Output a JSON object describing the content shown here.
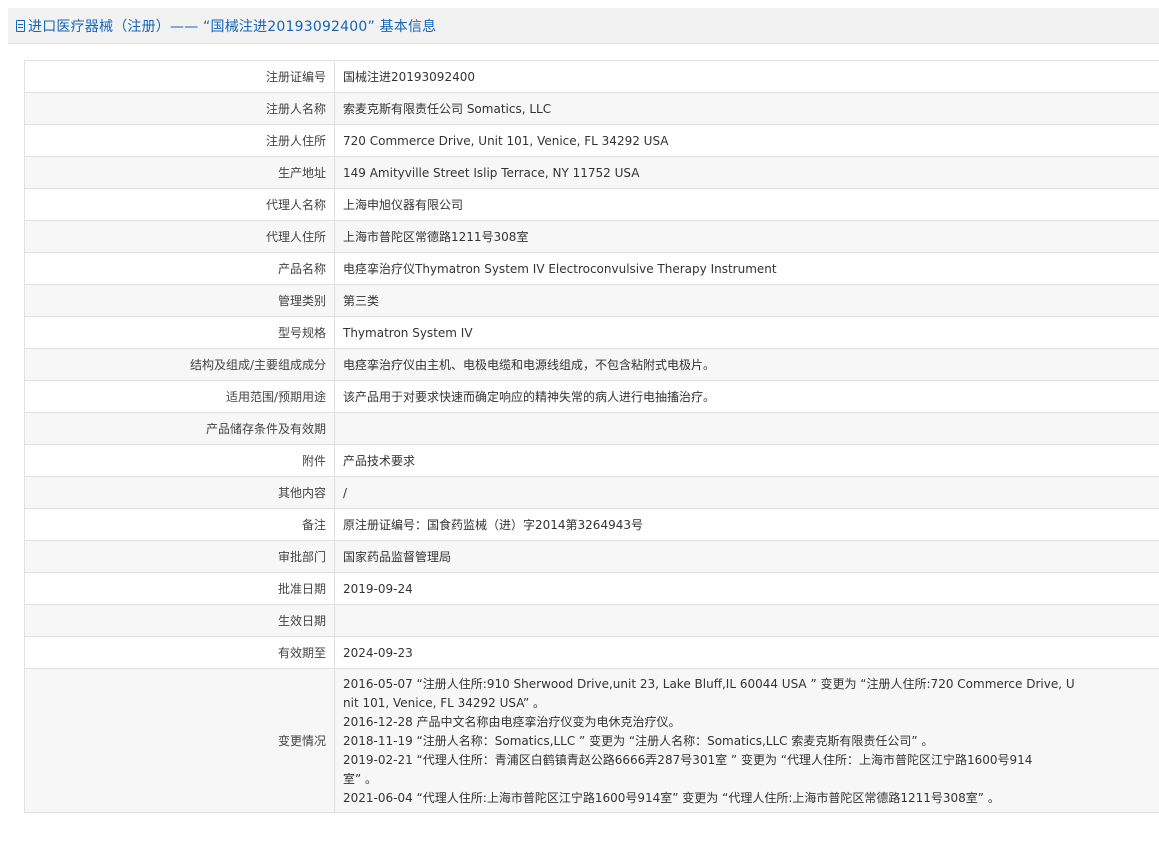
{
  "header": {
    "icon": "document-icon",
    "title": "进口医疗器械（注册）——  “国械注进20193092400” 基本信息"
  },
  "rows": [
    {
      "label": "注册证编号",
      "value": "国械注进20193092400"
    },
    {
      "label": "注册人名称",
      "value": "索麦克斯有限责任公司 Somatics, LLC"
    },
    {
      "label": "注册人住所",
      "value": "720 Commerce Drive, Unit 101, Venice, FL 34292 USA"
    },
    {
      "label": "生产地址",
      "value": "149 Amityville Street Islip Terrace, NY 11752 USA"
    },
    {
      "label": "代理人名称",
      "value": "上海申旭仪器有限公司"
    },
    {
      "label": "代理人住所",
      "value": "上海市普陀区常德路1211号308室"
    },
    {
      "label": "产品名称",
      "value": "电痉挛治疗仪Thymatron System IV Electroconvulsive Therapy Instrument"
    },
    {
      "label": "管理类别",
      "value": "第三类"
    },
    {
      "label": "型号规格",
      "value": "Thymatron System IV"
    },
    {
      "label": "结构及组成/主要组成成分",
      "value": "电痉挛治疗仪由主机、电极电缆和电源线组成，不包含粘附式电极片。"
    },
    {
      "label": "适用范围/预期用途",
      "value": "该产品用于对要求快速而确定响应的精神失常的病人进行电抽搐治疗。"
    },
    {
      "label": "产品储存条件及有效期",
      "value": ""
    },
    {
      "label": "附件",
      "value": "产品技术要求"
    },
    {
      "label": "其他内容",
      "value": "/"
    },
    {
      "label": "备注",
      "value": "原注册证编号：国食药监械（进）字2014第3264943号"
    },
    {
      "label": "审批部门",
      "value": "国家药品监督管理局"
    },
    {
      "label": "批准日期",
      "value": "2019-09-24"
    },
    {
      "label": "生效日期",
      "value": ""
    },
    {
      "label": "有效期至",
      "value": "2024-09-23"
    }
  ],
  "changes": {
    "label": "变更情况",
    "lines": [
      "2016-05-07 “注册人住所:910 Sherwood Drive,unit 23, Lake Bluff,IL 60044 USA ” 变更为 “注册人住所:720 Commerce Drive, U",
      "nit 101, Venice, FL 34292 USA” 。",
      "2016-12-28 产品中文名称由电痉挛治疗仪变为电休克治疗仪。",
      "2018-11-19 “注册人名称：Somatics,LLC ” 变更为 “注册人名称：Somatics,LLC 索麦克斯有限责任公司” 。",
      "2019-02-21 “代理人住所：青浦区白鹤镇青赵公路6666弄287号301室 ” 变更为 “代理人住所：上海市普陀区江宁路1600号914",
      "室” 。",
      "2021-06-04 “代理人住所:上海市普陀区江宁路1600号914室” 变更为 “代理人住所:上海市普陀区常德路1211号308室” 。"
    ]
  }
}
